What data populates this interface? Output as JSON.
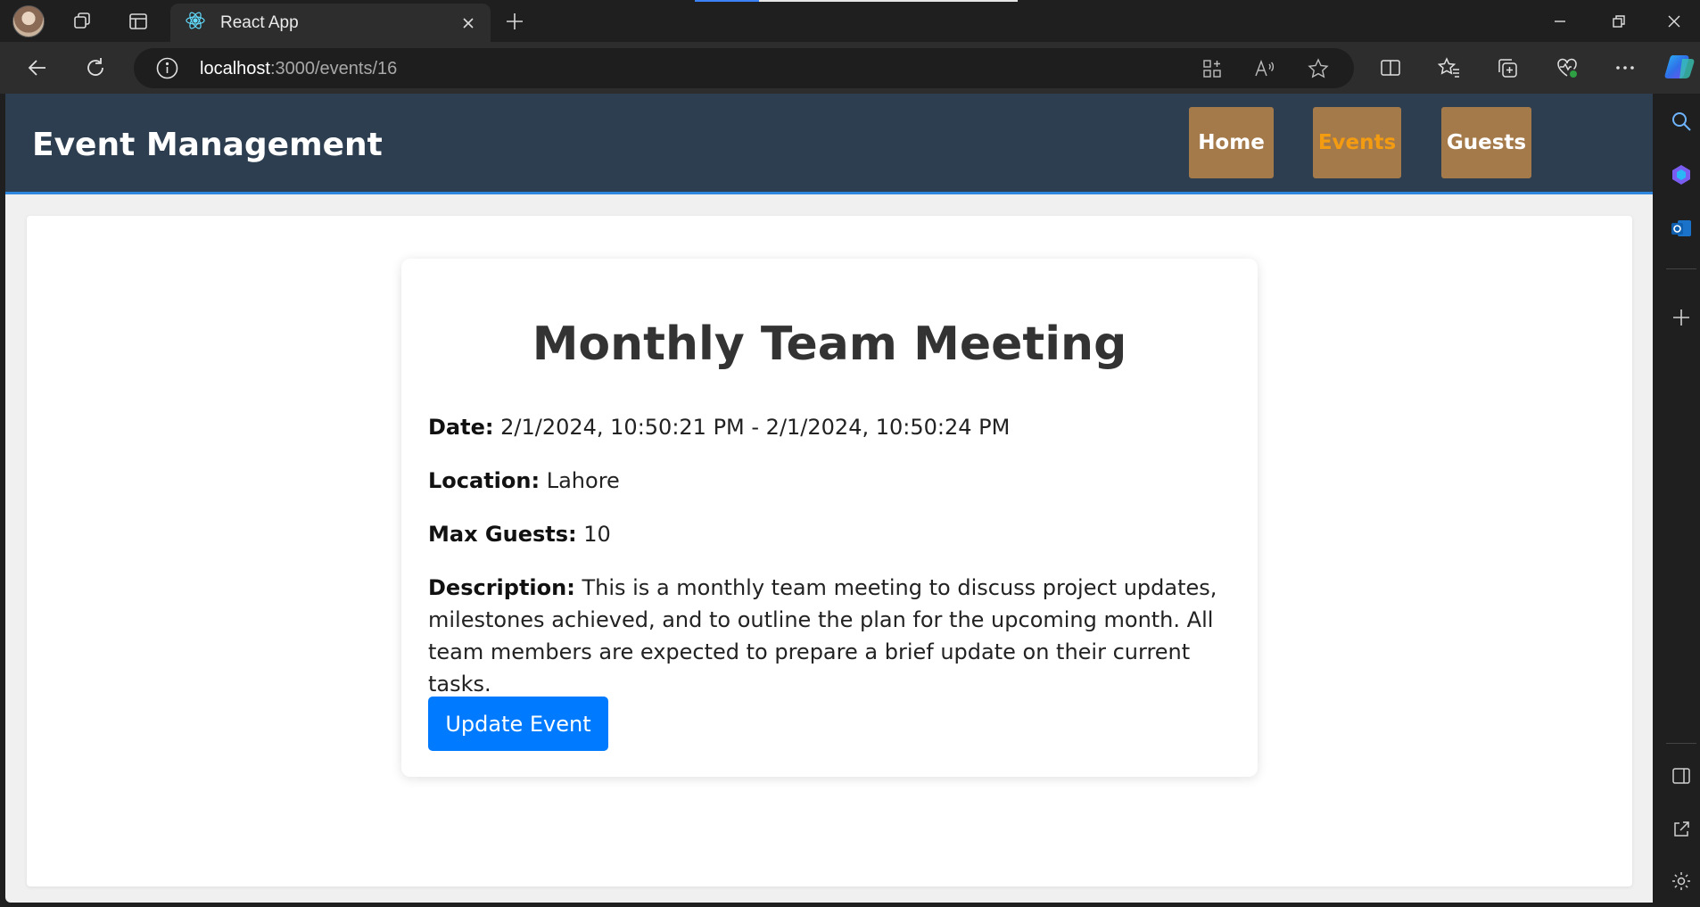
{
  "browser": {
    "tab_title": "React App",
    "url_host": "localhost",
    "url_path": ":3000/events/16"
  },
  "app": {
    "brand": "Event Management",
    "nav": [
      {
        "label": "Home",
        "active": false
      },
      {
        "label": "Events",
        "active": true
      },
      {
        "label": "Guests",
        "active": false
      }
    ]
  },
  "event": {
    "title": "Monthly Team Meeting",
    "date_label": "Date:",
    "date_value": "2/1/2024, 10:50:21 PM - 2/1/2024, 10:50:24 PM",
    "location_label": "Location:",
    "location_value": "Lahore",
    "max_guests_label": "Max Guests:",
    "max_guests_value": "10",
    "description_label": "Description:",
    "description_value": "This is a monthly team meeting to discuss project updates, milestones achieved, and to outline the plan for the upcoming month. All team members are expected to prepare a brief update on their current tasks.",
    "update_button": "Update Event"
  },
  "colors": {
    "header_bg": "#2c3e50",
    "nav_button_bg": "#a57a4a",
    "nav_active_text": "#f39c12",
    "primary_button": "#007bff"
  }
}
